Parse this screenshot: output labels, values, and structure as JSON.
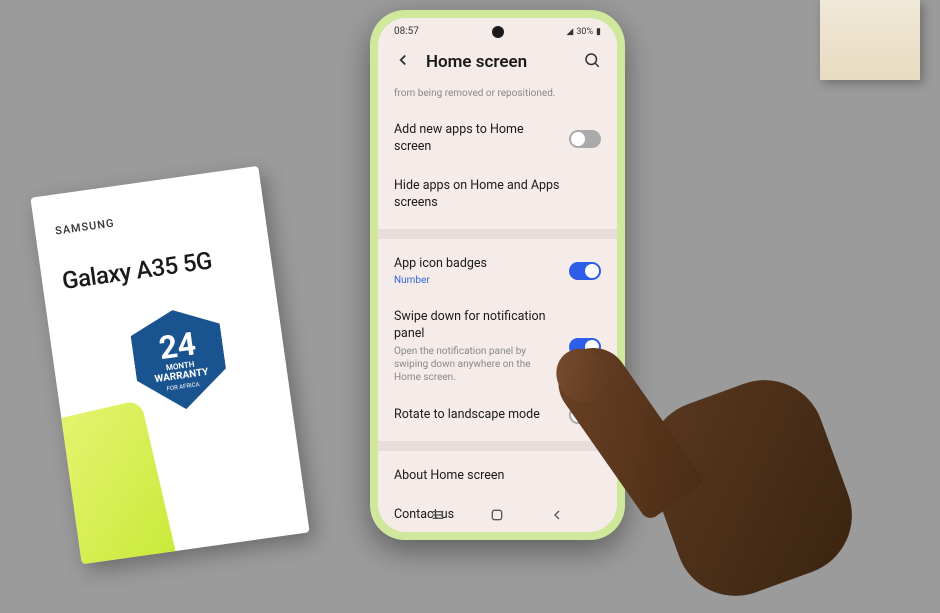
{
  "product_box": {
    "brand": "SAMSUNG",
    "model": "Galaxy A35 5G",
    "warranty": {
      "number": "24",
      "period": "MONTH",
      "label": "WARRANTY",
      "region": "FOR AFRICA"
    }
  },
  "status_bar": {
    "time": "08:57",
    "battery": "30%"
  },
  "header": {
    "title": "Home screen"
  },
  "settings": {
    "lock_subtitle": "from being removed or repositioned.",
    "add_apps": "Add new apps to Home screen",
    "hide_apps": "Hide apps on Home and Apps screens",
    "icon_badges": "App icon badges",
    "icon_badges_sub": "Number",
    "swipe_down": "Swipe down for notification panel",
    "swipe_down_sub": "Open the notification panel by swiping down anywhere on the Home screen.",
    "rotate": "Rotate to landscape mode",
    "about": "About Home screen",
    "contact": "Contact us"
  }
}
